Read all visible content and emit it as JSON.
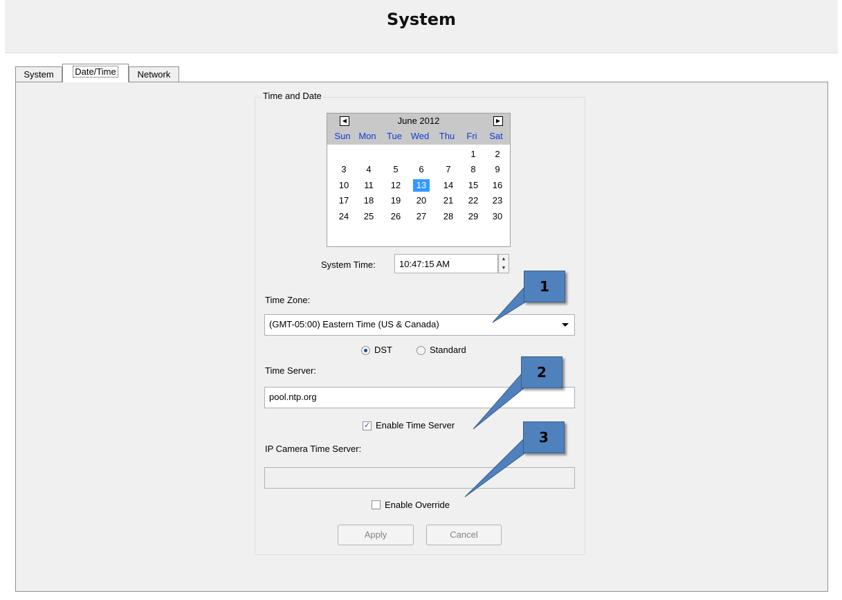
{
  "page_title": "System",
  "tabs": [
    {
      "label": "System",
      "active": false
    },
    {
      "label": "Date/Time",
      "active": true
    },
    {
      "label": "Network",
      "active": false
    }
  ],
  "group_title": "Time and Date",
  "calendar": {
    "month_label": "June 2012",
    "prev_icon": "triangle-left-icon",
    "next_icon": "triangle-right-icon",
    "days_of_week": [
      "Sun",
      "Mon",
      "Tue",
      "Wed",
      "Thu",
      "Fri",
      "Sat"
    ],
    "weeks": [
      [
        "",
        "",
        "",
        "",
        "",
        "1",
        "2"
      ],
      [
        "3",
        "4",
        "5",
        "6",
        "7",
        "8",
        "9"
      ],
      [
        "10",
        "11",
        "12",
        "13",
        "14",
        "15",
        "16"
      ],
      [
        "17",
        "18",
        "19",
        "20",
        "21",
        "22",
        "23"
      ],
      [
        "24",
        "25",
        "26",
        "27",
        "28",
        "29",
        "30"
      ]
    ],
    "selected_day": "13",
    "weekday_color": "#0c3cd4",
    "selected_color": "#3399ff"
  },
  "system_time": {
    "label": "System Time:",
    "value": "10:47:15 AM"
  },
  "time_zone": {
    "label": "Time Zone:",
    "value": "(GMT-05:00) Eastern Time (US & Canada)"
  },
  "dst": {
    "dst_label": "DST",
    "standard_label": "Standard",
    "selected": "DST"
  },
  "time_server": {
    "label": "Time Server:",
    "value": "pool.ntp.org",
    "enable_label": "Enable Time Server",
    "enabled": true
  },
  "ip_camera": {
    "label": "IP Camera Time Server:",
    "value": "",
    "override_label": "Enable Override",
    "override": false
  },
  "buttons": {
    "apply": "Apply",
    "cancel": "Cancel"
  },
  "callouts": [
    "1",
    "2",
    "3"
  ],
  "callout_color": "#4f81bd"
}
